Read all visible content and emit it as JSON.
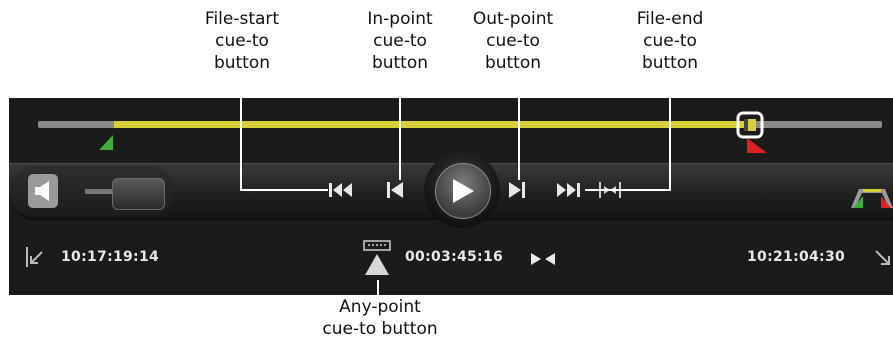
{
  "callouts": {
    "file_start": "File-start\ncue-to\nbutton",
    "in_point": "In-point\ncue-to\nbutton",
    "out_point": "Out-point\ncue-to\nbutton",
    "file_end": "File-end\ncue-to\nbutton",
    "any_point": "Any-point\ncue-to button"
  },
  "timeline": {
    "in_fraction": 0.09,
    "out_fraction": 0.84
  },
  "timecodes": {
    "start": "10:17:19:14",
    "duration": "00:03:45:16",
    "end": "10:21:04:30"
  },
  "colors": {
    "track": "#8a8a8a",
    "track_marked": "#d6cf3a",
    "in_marker": "#3fae3f",
    "out_marker": "#e02020"
  },
  "icons": {
    "speaker": "speaker-icon",
    "file_start": "skip-to-start-icon",
    "in_point": "cue-in-point-icon",
    "play": "play-icon",
    "out_point": "cue-out-point-icon",
    "file_end": "skip-to-end-icon",
    "any_point": "cue-any-point-icon",
    "bow_tie": "bow-tie-icon",
    "start_arrow": "arrow-down-left-icon",
    "end_arrow": "arrow-down-right-icon"
  }
}
